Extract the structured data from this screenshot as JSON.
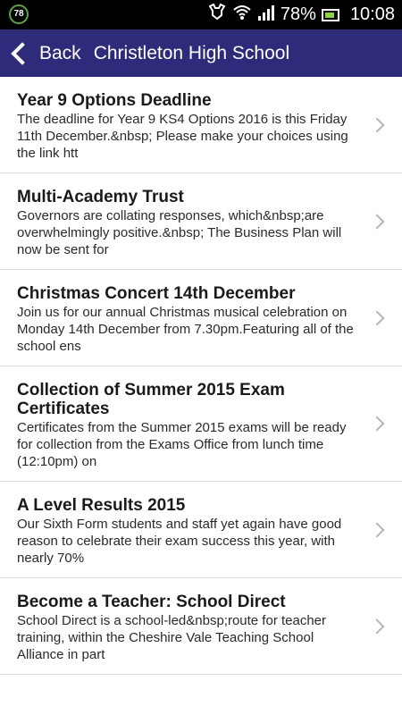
{
  "status_bar": {
    "badge": "78",
    "battery_pct": "78%",
    "time": "10:08"
  },
  "header": {
    "back_label": "Back",
    "title": "Christleton High School",
    "background_color": "#2e2b7a"
  },
  "news": [
    {
      "title": "Year 9 Options Deadline",
      "snippet": "The deadline for Year 9 KS4 Options 2016 is this Friday 11th December.&nbsp; Please make your choices using the link htt"
    },
    {
      "title": "Multi-Academy Trust",
      "snippet": "Governors are collating responses, which&nbsp;are overwhelmingly positive.&nbsp; The Business Plan will now be sent for"
    },
    {
      "title": "Christmas Concert 14th December",
      "snippet": "Join us for our annual Christmas musical celebration on Monday 14th December from 7.30pm.Featuring all of the school ens"
    },
    {
      "title": "Collection of Summer 2015 Exam Certificates",
      "snippet": "Certificates from the Summer 2015 exams will be ready for collection from the Exams Office from lunch time (12:10pm) on"
    },
    {
      "title": "A Level Results 2015",
      "snippet": "Our Sixth Form students and staff yet again have good reason to celebrate their exam success this year, with nearly 70%"
    },
    {
      "title": "Become a Teacher: School Direct",
      "snippet": "School Direct is a school-led&nbsp;route for teacher training, within the Cheshire Vale Teaching School Alliance in part"
    }
  ]
}
